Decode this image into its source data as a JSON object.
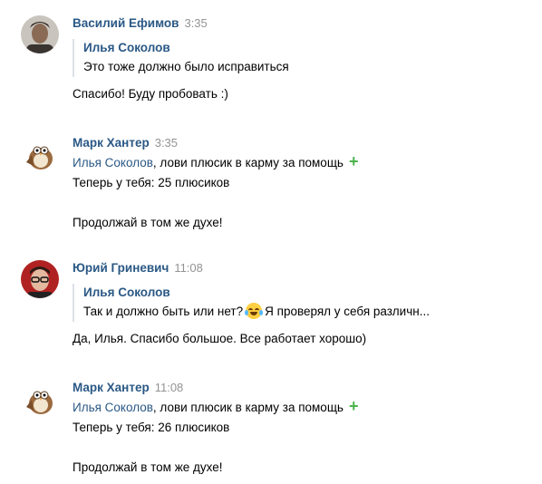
{
  "messages": [
    {
      "author": "Василий Ефимов",
      "time": "3:35",
      "avatar": "person-portrait",
      "quote": {
        "author": "Илья Соколов",
        "text": "Это тоже должно было исправиться"
      },
      "lines": [
        "Спасибо! Буду пробовать :)"
      ]
    },
    {
      "author": "Марк Хантер",
      "time": "3:35",
      "avatar": "owl-bot",
      "mention": "Илья Соколов",
      "mention_rest": ", лови плюсик в карму за помощь",
      "plus": "+",
      "lines": [
        "Теперь у тебя: 25 плюсиков",
        "",
        "Продолжай в том же духе!"
      ]
    },
    {
      "author": "Юрий Гриневич",
      "time": "11:08",
      "avatar": "person-glasses",
      "quote": {
        "author": "Илья Соколов",
        "text_before": "Так и должно быть или нет?",
        "emoji": "tears-of-joy",
        "text_after": "Я проверял у себя различн..."
      },
      "lines": [
        "Да, Илья. Спасибо большое. Все работает хорошо)"
      ]
    },
    {
      "author": "Марк Хантер",
      "time": "11:08",
      "avatar": "owl-bot",
      "mention": "Илья Соколов",
      "mention_rest": ", лови плюсик в карму за помощь",
      "plus": "+",
      "lines": [
        "Теперь у тебя: 26 плюсиков",
        "",
        "Продолжай в том же духе!"
      ]
    }
  ]
}
